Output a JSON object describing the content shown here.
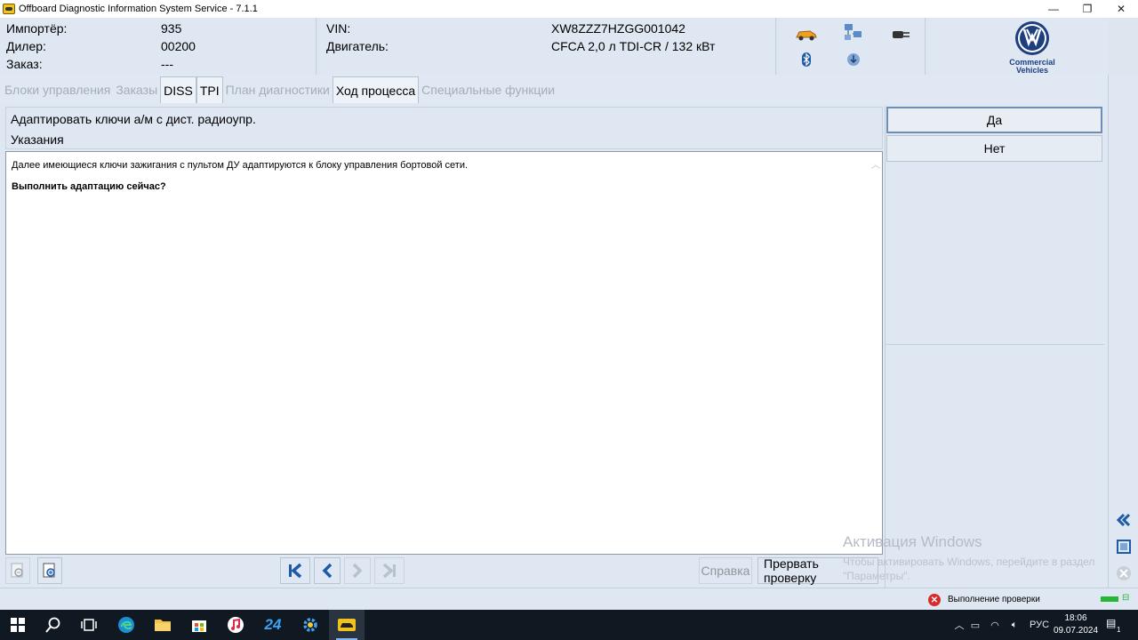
{
  "window": {
    "title": "Offboard Diagnostic Information System Service - 7.1.1",
    "minimize": "—",
    "maximize": "❐",
    "close": "✕"
  },
  "header": {
    "importer_label": "Импортёр:",
    "importer_value": "935",
    "dealer_label": "Дилер:",
    "dealer_value": "00200",
    "order_label": "Заказ:",
    "order_value": "---",
    "vin_label": "VIN:",
    "vin_value": "XW8ZZZ7HZGG001042",
    "engine_label": "Двигатель:",
    "engine_value": "CFCA 2,0 л TDI-CR / 132 кВт",
    "brand_line1": "Commercial",
    "brand_line2": "Vehicles",
    "brand_logo": "VW"
  },
  "tabs": [
    {
      "label": "Блоки управления",
      "active": false
    },
    {
      "label": "Заказы",
      "active": false
    },
    {
      "label": "DISS",
      "active": true
    },
    {
      "label": "TPI",
      "active": true
    },
    {
      "label": "План диагностики",
      "active": false
    },
    {
      "label": "Ход процесса",
      "active": true
    },
    {
      "label": "Специальные функции",
      "active": false
    }
  ],
  "main": {
    "title": "Адаптировать ключи а/м с дист. радиоупр.",
    "section": "Указания",
    "text_line1": "Далее имеющиеся ключи зажигания с пультом ДУ адаптируются к блоку управления бортовой сети.",
    "text_line2": "Выполнить адаптацию сейчас?"
  },
  "answers": {
    "yes": "Да",
    "no": "Нет"
  },
  "toolbar": {
    "help": "Справка",
    "abort": "Прервать проверку"
  },
  "watermark": {
    "title": "Активация Windows",
    "subtitle": "Чтобы активировать Windows, перейдите в раздел \"Параметры\"."
  },
  "status": {
    "text": "Выполнение проверки"
  },
  "taskbar": {
    "lang": "РУС",
    "time": "18:06",
    "date": "09.07.2024",
    "notifications": "1",
    "app_24_label": "24"
  },
  "colors": {
    "panel_bg": "#dfe7f2",
    "accent_blue": "#1f5aa6",
    "error_red": "#d62b2b",
    "progress_green": "#25b634",
    "taskbar_bg": "#101922"
  }
}
